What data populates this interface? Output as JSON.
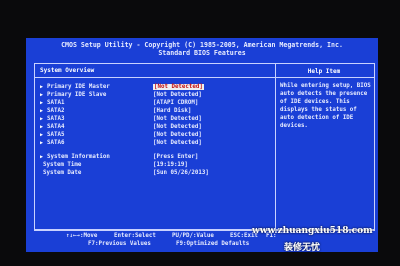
{
  "header": {
    "title_line1": "CMOS Setup Utility - Copyright (C) 1985-2005, American Megatrends, Inc.",
    "title_line2": "Standard BIOS Features"
  },
  "main_panel": {
    "section_title": "System Overview",
    "devices": [
      {
        "label": "Primary IDE Master",
        "value": "[Not Detected]"
      },
      {
        "label": "Primary IDE Slave",
        "value": "[Not Detected]"
      },
      {
        "label": "SATA1",
        "value": "[ATAPI CDROM]"
      },
      {
        "label": "SATA2",
        "value": "[Hard Disk]"
      },
      {
        "label": "SATA3",
        "value": "[Not Detected]"
      },
      {
        "label": "SATA4",
        "value": "[Not Detected]"
      },
      {
        "label": "SATA5",
        "value": "[Not Detected]"
      },
      {
        "label": "SATA6",
        "value": "[Not Detected]"
      }
    ],
    "system_information": {
      "label": "System Information",
      "value": "[Press Enter]"
    },
    "system_time": {
      "label": "System Time",
      "value": "[19:19:19]"
    },
    "system_date": {
      "label": "System Date",
      "value": "[Sun 05/26/2013]"
    }
  },
  "help_panel": {
    "title": "Help Item",
    "text": "While entering setup, BIOS auto detects the presence of IDE devices. This displays the status of auto detection of IDE devices."
  },
  "footer": {
    "move": "↑↓←→:Move",
    "select": "Enter:Select",
    "value": "PU/PD/:Value",
    "exit": "ESC:Exit",
    "f1": "F1:",
    "prev": "F7:Previous Values",
    "optimized": "F9:Optimized Defaults"
  },
  "watermark": {
    "url": "www.zhuangxiu518.com",
    "name": "装修无忧"
  },
  "colors": {
    "bios_blue": "#1a3fd6",
    "highlight_bg": "#f0f0f0",
    "highlight_text": "#c31010"
  },
  "icons": {
    "submenu_marker": "triangle-right-icon"
  }
}
